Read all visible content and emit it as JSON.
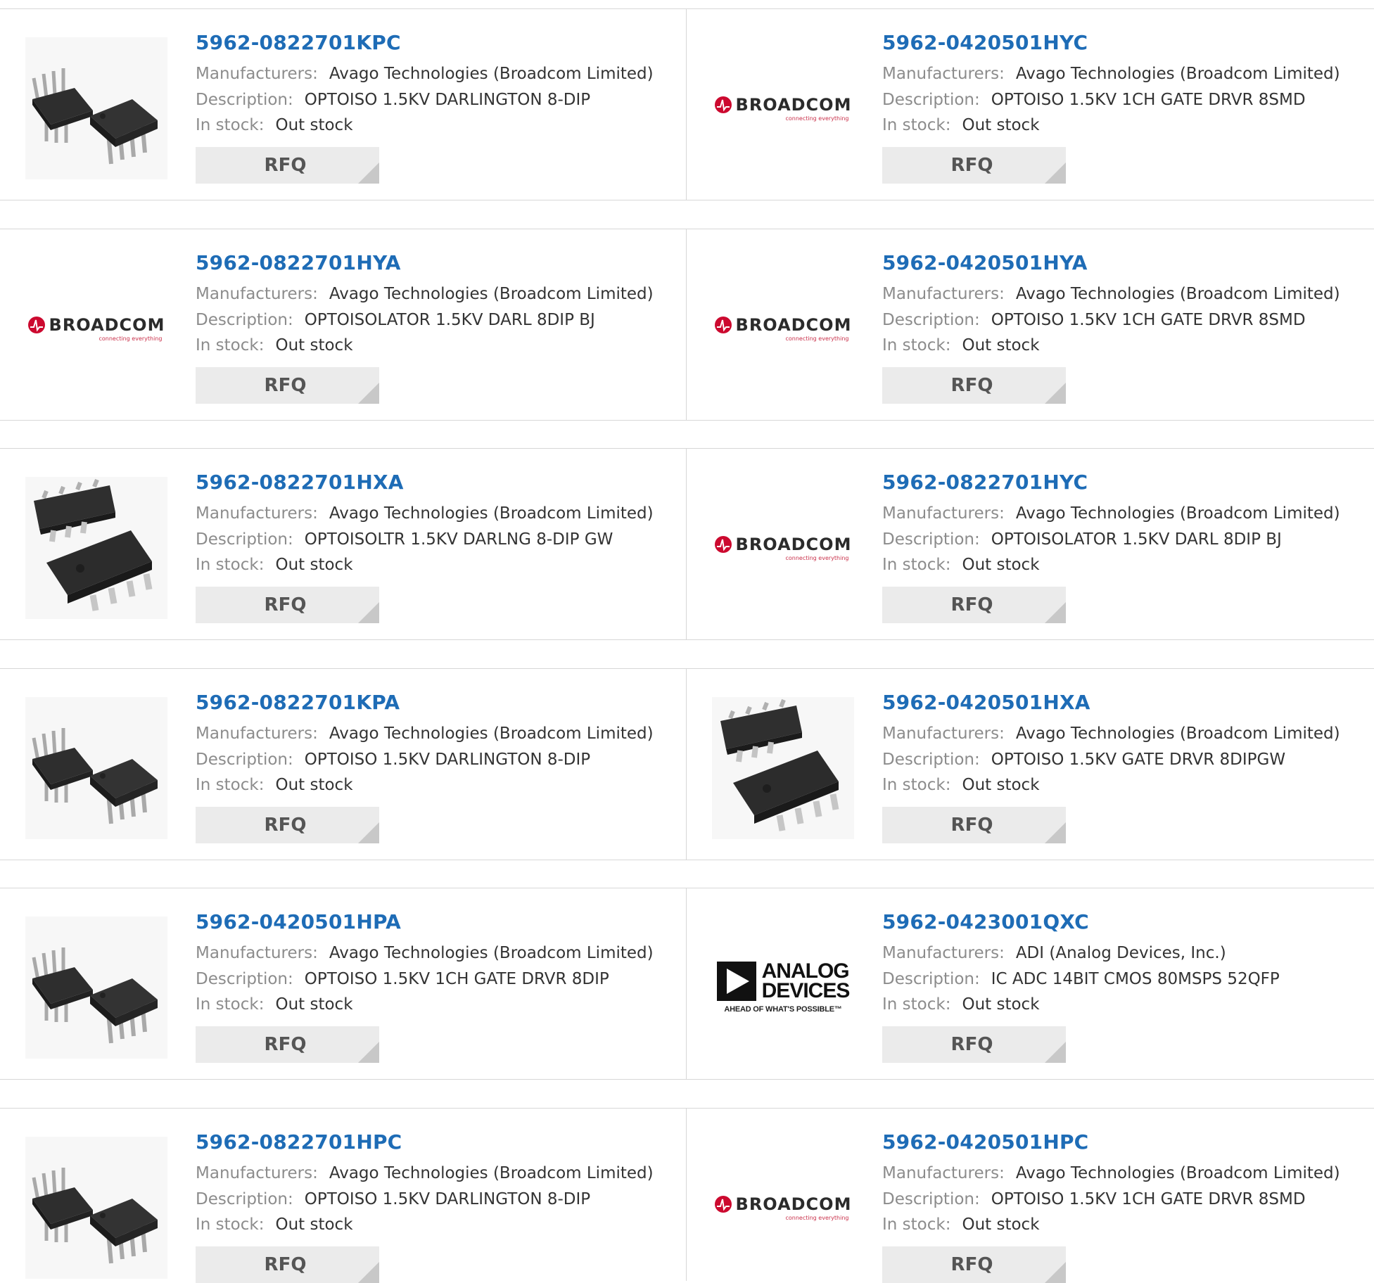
{
  "labels": {
    "manufacturers": "Manufacturers:",
    "description": "Description:",
    "in_stock": "In stock:",
    "rfq": "RFQ"
  },
  "brand_logos": {
    "broadcom": "BROADCOM",
    "broadcom_tag": "connecting everything",
    "analog_line1": "ANALOG",
    "analog_line2": "DEVICES",
    "analog_tag": "AHEAD OF WHAT'S POSSIBLE™"
  },
  "colors": {
    "part_link": "#1e6cb6",
    "broadcom_red": "#cc092f",
    "rfq_bg": "#ebebeb"
  },
  "products": [
    {
      "part": "5962-0822701KPC",
      "manufacturer": "Avago Technologies (Broadcom Limited)",
      "description": "OPTOISO 1.5KV DARLINGTON 8-DIP",
      "stock": "Out stock",
      "image": "dip8-chip-photo"
    },
    {
      "part": "5962-0420501HYC",
      "manufacturer": "Avago Technologies (Broadcom Limited)",
      "description": "OPTOISO 1.5KV 1CH GATE DRVR 8SMD",
      "stock": "Out stock",
      "image": "broadcom-logo"
    },
    {
      "part": "5962-0822701HYA",
      "manufacturer": "Avago Technologies (Broadcom Limited)",
      "description": "OPTOISOLATOR 1.5KV DARL 8DIP BJ",
      "stock": "Out stock",
      "image": "broadcom-logo"
    },
    {
      "part": "5962-0420501HYA",
      "manufacturer": "Avago Technologies (Broadcom Limited)",
      "description": "OPTOISO 1.5KV 1CH GATE DRVR 8SMD",
      "stock": "Out stock",
      "image": "broadcom-logo"
    },
    {
      "part": "5962-0822701HXA",
      "manufacturer": "Avago Technologies (Broadcom Limited)",
      "description": "OPTOISOLTR 1.5KV DARLNG 8-DIP GW",
      "stock": "Out stock",
      "image": "gullwing-chip-photo"
    },
    {
      "part": "5962-0822701HYC",
      "manufacturer": "Avago Technologies (Broadcom Limited)",
      "description": "OPTOISOLATOR 1.5KV DARL 8DIP BJ",
      "stock": "Out stock",
      "image": "broadcom-logo"
    },
    {
      "part": "5962-0822701KPA",
      "manufacturer": "Avago Technologies (Broadcom Limited)",
      "description": "OPTOISO 1.5KV DARLINGTON 8-DIP",
      "stock": "Out stock",
      "image": "dip8-chip-photo"
    },
    {
      "part": "5962-0420501HXA",
      "manufacturer": "Avago Technologies (Broadcom Limited)",
      "description": "OPTOISO 1.5KV GATE DRVR 8DIPGW",
      "stock": "Out stock",
      "image": "gullwing-chip-photo"
    },
    {
      "part": "5962-0420501HPA",
      "manufacturer": "Avago Technologies (Broadcom Limited)",
      "description": "OPTOISO 1.5KV 1CH GATE DRVR 8DIP",
      "stock": "Out stock",
      "image": "dip8-chip-photo"
    },
    {
      "part": "5962-0423001QXC",
      "manufacturer": "ADI (Analog Devices, Inc.)",
      "description": "IC ADC 14BIT CMOS 80MSPS 52QFP",
      "stock": "Out stock",
      "image": "analog-devices-logo"
    },
    {
      "part": "5962-0822701HPC",
      "manufacturer": "Avago Technologies (Broadcom Limited)",
      "description": "OPTOISO 1.5KV DARLINGTON 8-DIP",
      "stock": "Out stock",
      "image": "dip8-chip-photo"
    },
    {
      "part": "5962-0420501HPC",
      "manufacturer": "Avago Technologies (Broadcom Limited)",
      "description": "OPTOISO 1.5KV 1CH GATE DRVR 8SMD",
      "stock": "Out stock",
      "image": "broadcom-logo"
    }
  ]
}
